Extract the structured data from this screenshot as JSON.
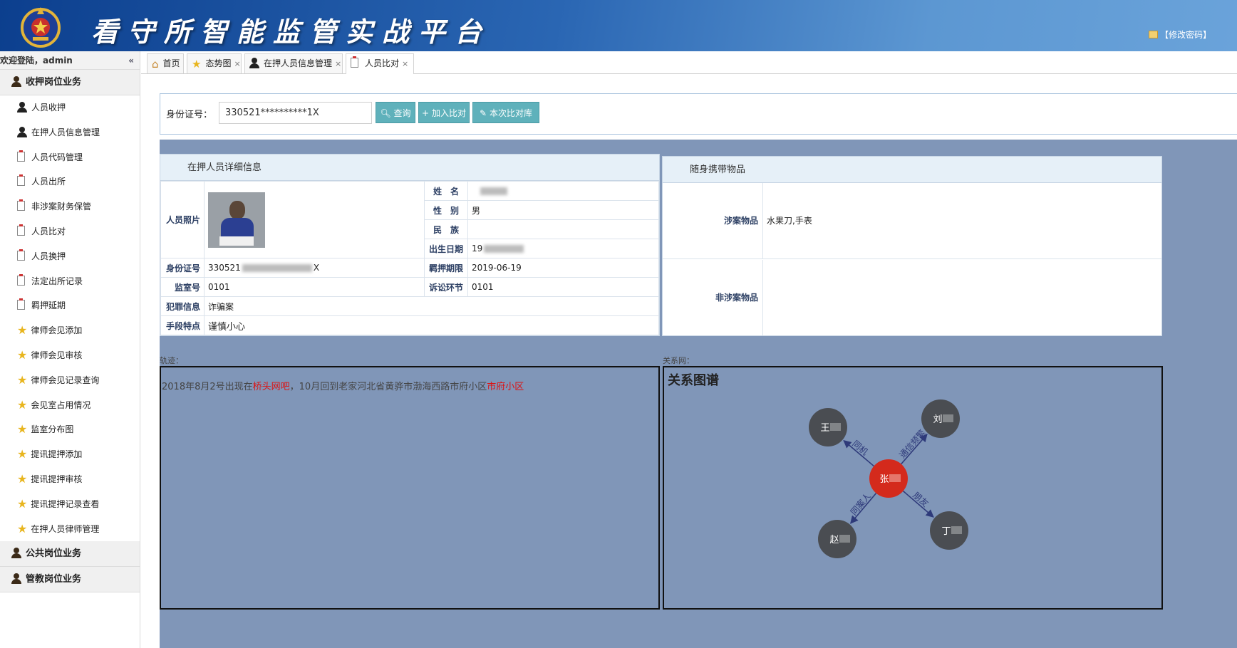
{
  "header": {
    "title": "看守所智能监管实战平台",
    "change_password": "【修改密码】"
  },
  "sidebar": {
    "welcome": "欢迎登陆，admin",
    "collapse_icon": "«",
    "groups": [
      {
        "label": "收押岗位业务",
        "items": [
          {
            "label": "人员收押",
            "icon": "person-icon"
          },
          {
            "label": "在押人员信息管理",
            "icon": "person-icon"
          },
          {
            "label": "人员代码管理",
            "icon": "clipboard-icon"
          },
          {
            "label": "人员出所",
            "icon": "clipboard-icon"
          },
          {
            "label": "非涉案财务保管",
            "icon": "clipboard-icon"
          },
          {
            "label": "人员比对",
            "icon": "clipboard-icon"
          },
          {
            "label": "人员换押",
            "icon": "clipboard-icon"
          },
          {
            "label": "法定出所记录",
            "icon": "clipboard-icon"
          },
          {
            "label": "羁押延期",
            "icon": "clipboard-icon"
          },
          {
            "label": "律师会见添加",
            "icon": "star-icon"
          },
          {
            "label": "律师会见审核",
            "icon": "star-icon"
          },
          {
            "label": "律师会见记录查询",
            "icon": "star-icon"
          },
          {
            "label": "会见室占用情况",
            "icon": "star-icon"
          },
          {
            "label": "监室分布图",
            "icon": "star-icon"
          },
          {
            "label": "提讯提押添加",
            "icon": "star-icon"
          },
          {
            "label": "提讯提押审核",
            "icon": "star-icon"
          },
          {
            "label": "提讯提押记录查看",
            "icon": "star-icon"
          },
          {
            "label": "在押人员律师管理",
            "icon": "star-icon"
          }
        ]
      },
      {
        "label": "公共岗位业务"
      },
      {
        "label": "管教岗位业务"
      }
    ]
  },
  "tabs": [
    {
      "label": "首页",
      "icon": "home-icon",
      "closable": false
    },
    {
      "label": "态势图",
      "icon": "star-icon",
      "closable": true
    },
    {
      "label": "在押人员信息管理",
      "icon": "person-icon",
      "closable": true
    },
    {
      "label": "人员比对",
      "icon": "clipboard-icon",
      "closable": true,
      "active": true
    }
  ],
  "tab_close": "×",
  "search": {
    "label": "身份证号：",
    "value": "330521**********1X",
    "buttons": {
      "query": "查询",
      "add": "加入比对",
      "library": "本次比对库"
    }
  },
  "detail": {
    "title": "在押人员详细信息",
    "photo_label": "人员照片",
    "fields": {
      "name": {
        "label": "姓　名",
        "value": ""
      },
      "gender": {
        "label": "性　别",
        "value": "男"
      },
      "ethnicity": {
        "label": "民　族",
        "value": ""
      },
      "birth": {
        "label": "出生日期",
        "value": "19"
      },
      "id_no": {
        "label": "身份证号",
        "value": "330521",
        "suffix": "X"
      },
      "detention_period": {
        "label": "羁押期限",
        "value": "2019-06-19"
      },
      "cell_no": {
        "label": "监室号",
        "value": "0101"
      },
      "litigation": {
        "label": "诉讼环节",
        "value": "0101"
      },
      "crime": {
        "label": "犯罪信息",
        "value": "诈骗案"
      },
      "method": {
        "label": "手段特点",
        "value": "谨慎小心"
      }
    }
  },
  "belongings": {
    "title": "随身携带物品",
    "involved": {
      "label": "涉案物品",
      "value": "水果刀,手表"
    },
    "uninvolved": {
      "label": "非涉案物品",
      "value": ""
    }
  },
  "track": {
    "label": "轨迹：",
    "parts": [
      {
        "text": "2018年8月2号出现在",
        "highlight": false
      },
      {
        "text": "桥头网吧",
        "highlight": true
      },
      {
        "text": "，10月回到老家河北省黄骅市渤海西路市府小区",
        "highlight": false
      },
      {
        "text": "市府小区",
        "highlight": true
      }
    ]
  },
  "relations": {
    "label": "关系网：",
    "title": "关系图谱",
    "center": {
      "label": "张"
    },
    "nodes": [
      {
        "label": "王",
        "relation": "同机"
      },
      {
        "label": "刘",
        "relation": "通信频繁"
      },
      {
        "label": "赵",
        "relation": "同案人"
      },
      {
        "label": "丁",
        "relation": "朋友"
      }
    ]
  },
  "colors": {
    "accent": "#5fb1bb",
    "panel": "#8096b8",
    "highlight": "#dd1111",
    "center_node": "#d42a1c",
    "node": "#4a4d52",
    "edge": "#2e3a7a"
  }
}
